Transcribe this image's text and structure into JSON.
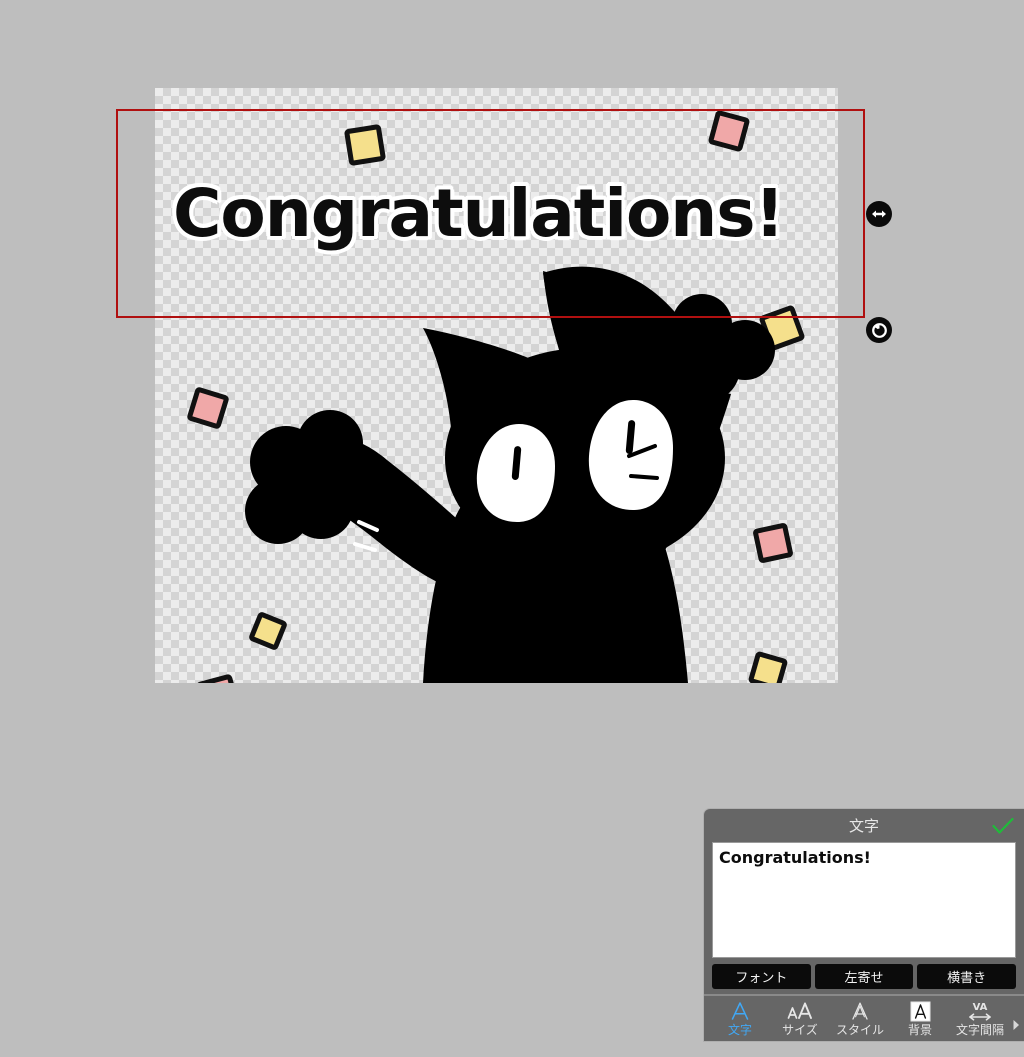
{
  "canvas": {
    "artwork_title": "celebrating-cat-sticker",
    "headline_text": "Congratulations!",
    "headline_color": "#0d0d0d",
    "headline_outline_color": "#ffffff",
    "background_label": "transparent-checkerboard",
    "confetti": {
      "yellow": "#f5e08c",
      "pink": "#f0a8a8",
      "outline": "#111111"
    },
    "cat_color": "#000000",
    "eye_color": "#ffffff"
  },
  "selection": {
    "border_color": "#b01010",
    "resize_handle_icon": "horizontal-resize-icon",
    "rotate_handle_icon": "rotate-icon"
  },
  "panel": {
    "title": "文字",
    "confirm_icon": "check-icon",
    "confirm_color": "#1fbb3a",
    "text_value": "Congratulations!",
    "text_placeholder": "",
    "options": [
      {
        "label": "フォント",
        "name": "font-button"
      },
      {
        "label": "左寄せ",
        "name": "align-button"
      },
      {
        "label": "横書き",
        "name": "writing-direction-button"
      }
    ],
    "tabs": [
      {
        "label": "文字",
        "icon": "letter-a-icon",
        "active": true
      },
      {
        "label": "サイズ",
        "icon": "double-a-size-icon",
        "active": false
      },
      {
        "label": "スタイル",
        "icon": "outline-a-icon",
        "active": false
      },
      {
        "label": "背景",
        "icon": "boxed-a-icon",
        "active": false
      },
      {
        "label": "文字間隔",
        "icon": "letter-spacing-icon",
        "active": false
      }
    ],
    "more_icon": "chevron-right-icon",
    "active_tab_color": "#41a8f5",
    "panel_bg": "#666666"
  }
}
